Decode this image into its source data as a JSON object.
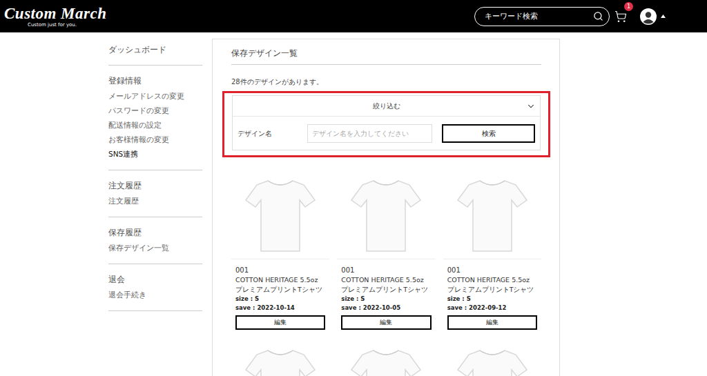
{
  "header": {
    "logo": "Custom March",
    "tagline": "Custom just for you.",
    "search": {
      "placeholder": "キーワード検索"
    },
    "cart": {
      "badge": "1"
    }
  },
  "sidebar": {
    "top": {
      "label": "ダッシュボード",
      "selected": false
    },
    "groups": [
      {
        "heading": "登録情報",
        "items": [
          {
            "label": "メールアドレスの変更",
            "selected": false
          },
          {
            "label": "パスワードの変更",
            "selected": false
          },
          {
            "label": "配送情報の設定",
            "selected": false
          },
          {
            "label": "お客様情報の変更",
            "selected": false
          },
          {
            "label": "SNS連携",
            "selected": true
          }
        ]
      },
      {
        "heading": "注文履歴",
        "items": [
          {
            "label": "注文履歴",
            "selected": false
          }
        ]
      },
      {
        "heading": "保存履歴",
        "items": [
          {
            "label": "保存デザイン一覧",
            "selected": false
          }
        ]
      },
      {
        "heading": "退会",
        "items": [
          {
            "label": "退会手続き",
            "selected": false
          }
        ]
      }
    ]
  },
  "page": {
    "title": "保存デザイン一覧",
    "count": "28件のデザインがあります。"
  },
  "filter": {
    "title": "絞り込む",
    "expanded": true,
    "highlighted": true,
    "field_label": "デザイン名",
    "placeholder": "デザイン名を入力してください",
    "button": "検索"
  },
  "cards": [
    {
      "kind": "full",
      "number": "001",
      "name": "COTTON HERITAGE 5.5oz プレミアムプリントTシャツ",
      "size": "size : S",
      "save": "save : 2022-10-14",
      "button": "編集"
    },
    {
      "kind": "full",
      "number": "001",
      "name": "COTTON HERITAGE 5.5oz プレミアムプリントTシャツ",
      "size": "size : S",
      "save": "save : 2022-10-05",
      "button": "編集"
    },
    {
      "kind": "full",
      "number": "001",
      "name": "COTTON HERITAGE 5.5oz プレミアムプリントTシャツ",
      "size": "size : S",
      "save": "save : 2022-09-12",
      "button": "編集"
    },
    {
      "kind": "image-only"
    },
    {
      "kind": "image-only"
    },
    {
      "kind": "image-only"
    }
  ]
}
